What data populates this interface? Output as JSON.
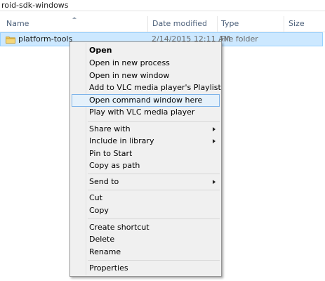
{
  "window": {
    "path": "roid-sdk-windows"
  },
  "columns": {
    "name": "Name",
    "date": "Date modified",
    "type": "Type",
    "size": "Size"
  },
  "rows": [
    {
      "name": "platform-tools",
      "date": "2/14/2015 12:11 AM",
      "type": "File folder",
      "icon": "folder-icon"
    }
  ],
  "context_menu": {
    "items": [
      {
        "label": "Open",
        "bold": true
      },
      {
        "label": "Open in new process"
      },
      {
        "label": "Open in new window"
      },
      {
        "label": "Add to VLC media player's Playlist"
      },
      {
        "label": "Open command window here",
        "highlighted": true
      },
      {
        "label": "Play with VLC media player"
      },
      {
        "label": "Share with",
        "submenu": true
      },
      {
        "label": "Include in library",
        "submenu": true
      },
      {
        "label": "Pin to Start"
      },
      {
        "label": "Copy as path"
      },
      {
        "label": "Send to",
        "submenu": true
      },
      {
        "label": "Cut"
      },
      {
        "label": "Copy"
      },
      {
        "label": "Create shortcut"
      },
      {
        "label": "Delete"
      },
      {
        "label": "Rename"
      },
      {
        "label": "Properties"
      }
    ]
  },
  "colors": {
    "selection_bg": "#cce8ff",
    "selection_border": "#99d1ff",
    "menu_highlight": "#e5f1fb"
  }
}
